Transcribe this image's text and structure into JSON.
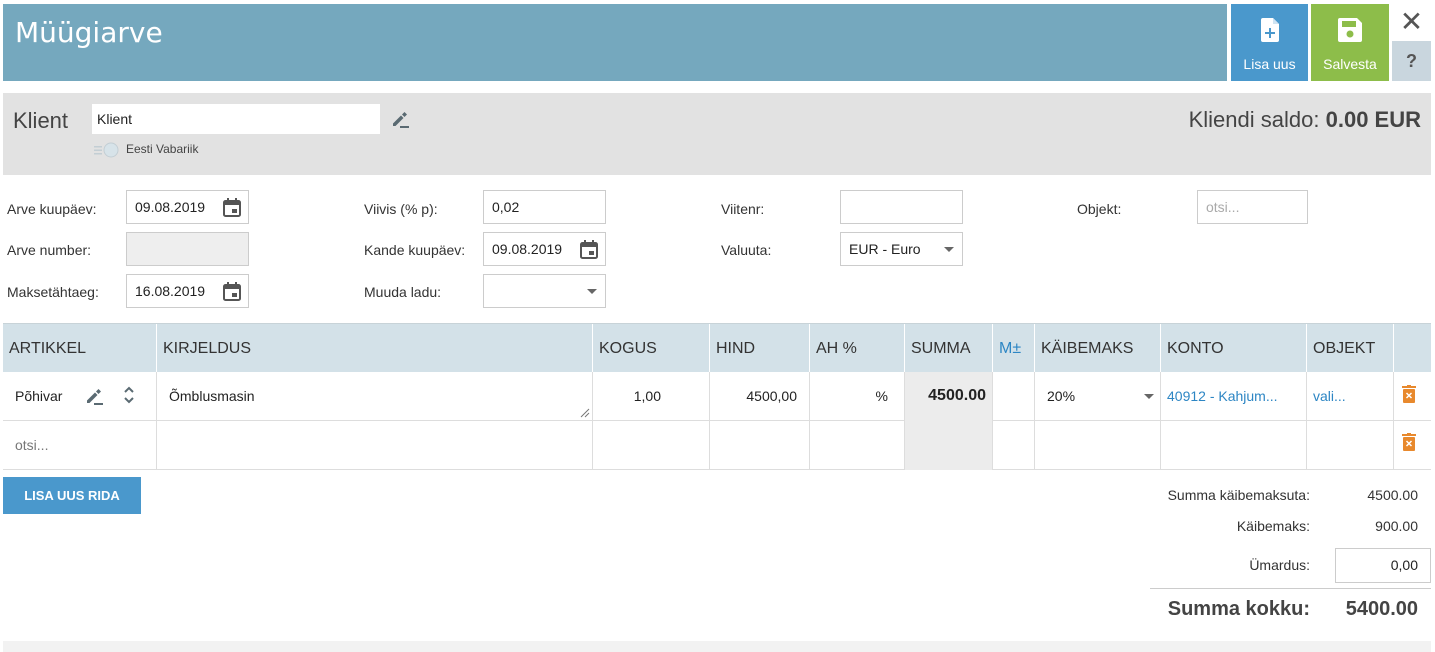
{
  "header": {
    "title": "Müügiarve",
    "new_label": "Lisa uus",
    "save_label": "Salvesta",
    "close": "✕",
    "help": "?",
    "color": "#75a8be"
  },
  "client": {
    "label": "Klient",
    "input_value": "Klient",
    "country": "Eesti Vabariik",
    "saldo_label": "Kliendi saldo:",
    "saldo_value": "0.00 EUR"
  },
  "form": {
    "invoice_date_label": "Arve kuupäev:",
    "invoice_date": "09.08.2019",
    "invoice_number_label": "Arve number:",
    "invoice_number": "",
    "due_date_label": "Maksetähtaeg:",
    "due_date": "16.08.2019",
    "penalty_label": "Viivis (% p):",
    "penalty": "0,02",
    "entry_date_label": "Kande kuupäev:",
    "entry_date": "09.08.2019",
    "warehouse_label": "Muuda ladu:",
    "warehouse": "",
    "reference_label": "Viitenr:",
    "reference": "",
    "currency_label": "Valuuta:",
    "currency": "EUR - Euro",
    "object_label": "Objekt:",
    "object_placeholder": "otsi..."
  },
  "table": {
    "headers": [
      "ARTIKKEL",
      "KIRJELDUS",
      "KOGUS",
      "HIND",
      "AH %",
      "SUMMA",
      "M±",
      "KÄIBEMAKS",
      "KONTO",
      "OBJEKT"
    ],
    "row1": {
      "article": "Põhivar",
      "description": "Õmblusmasin",
      "quantity": "1,00",
      "price": "4500,00",
      "discount": "%",
      "sum": "4500.00",
      "vat": "20%",
      "account": "40912 - Kahjum...",
      "object": "vali..."
    },
    "row2": {
      "article_placeholder": "otsi..."
    }
  },
  "add_row_label": "LISA UUS RIDA",
  "totals": {
    "net_label": "Summa käibemaksuta:",
    "net_value": "4500.00",
    "vat_label": "Käibemaks:",
    "vat_value": "900.00",
    "rounding_label": "Ümardus:",
    "rounding_value": "0,00",
    "grand_label": "Summa kokku:",
    "grand_value": "5400.00"
  }
}
